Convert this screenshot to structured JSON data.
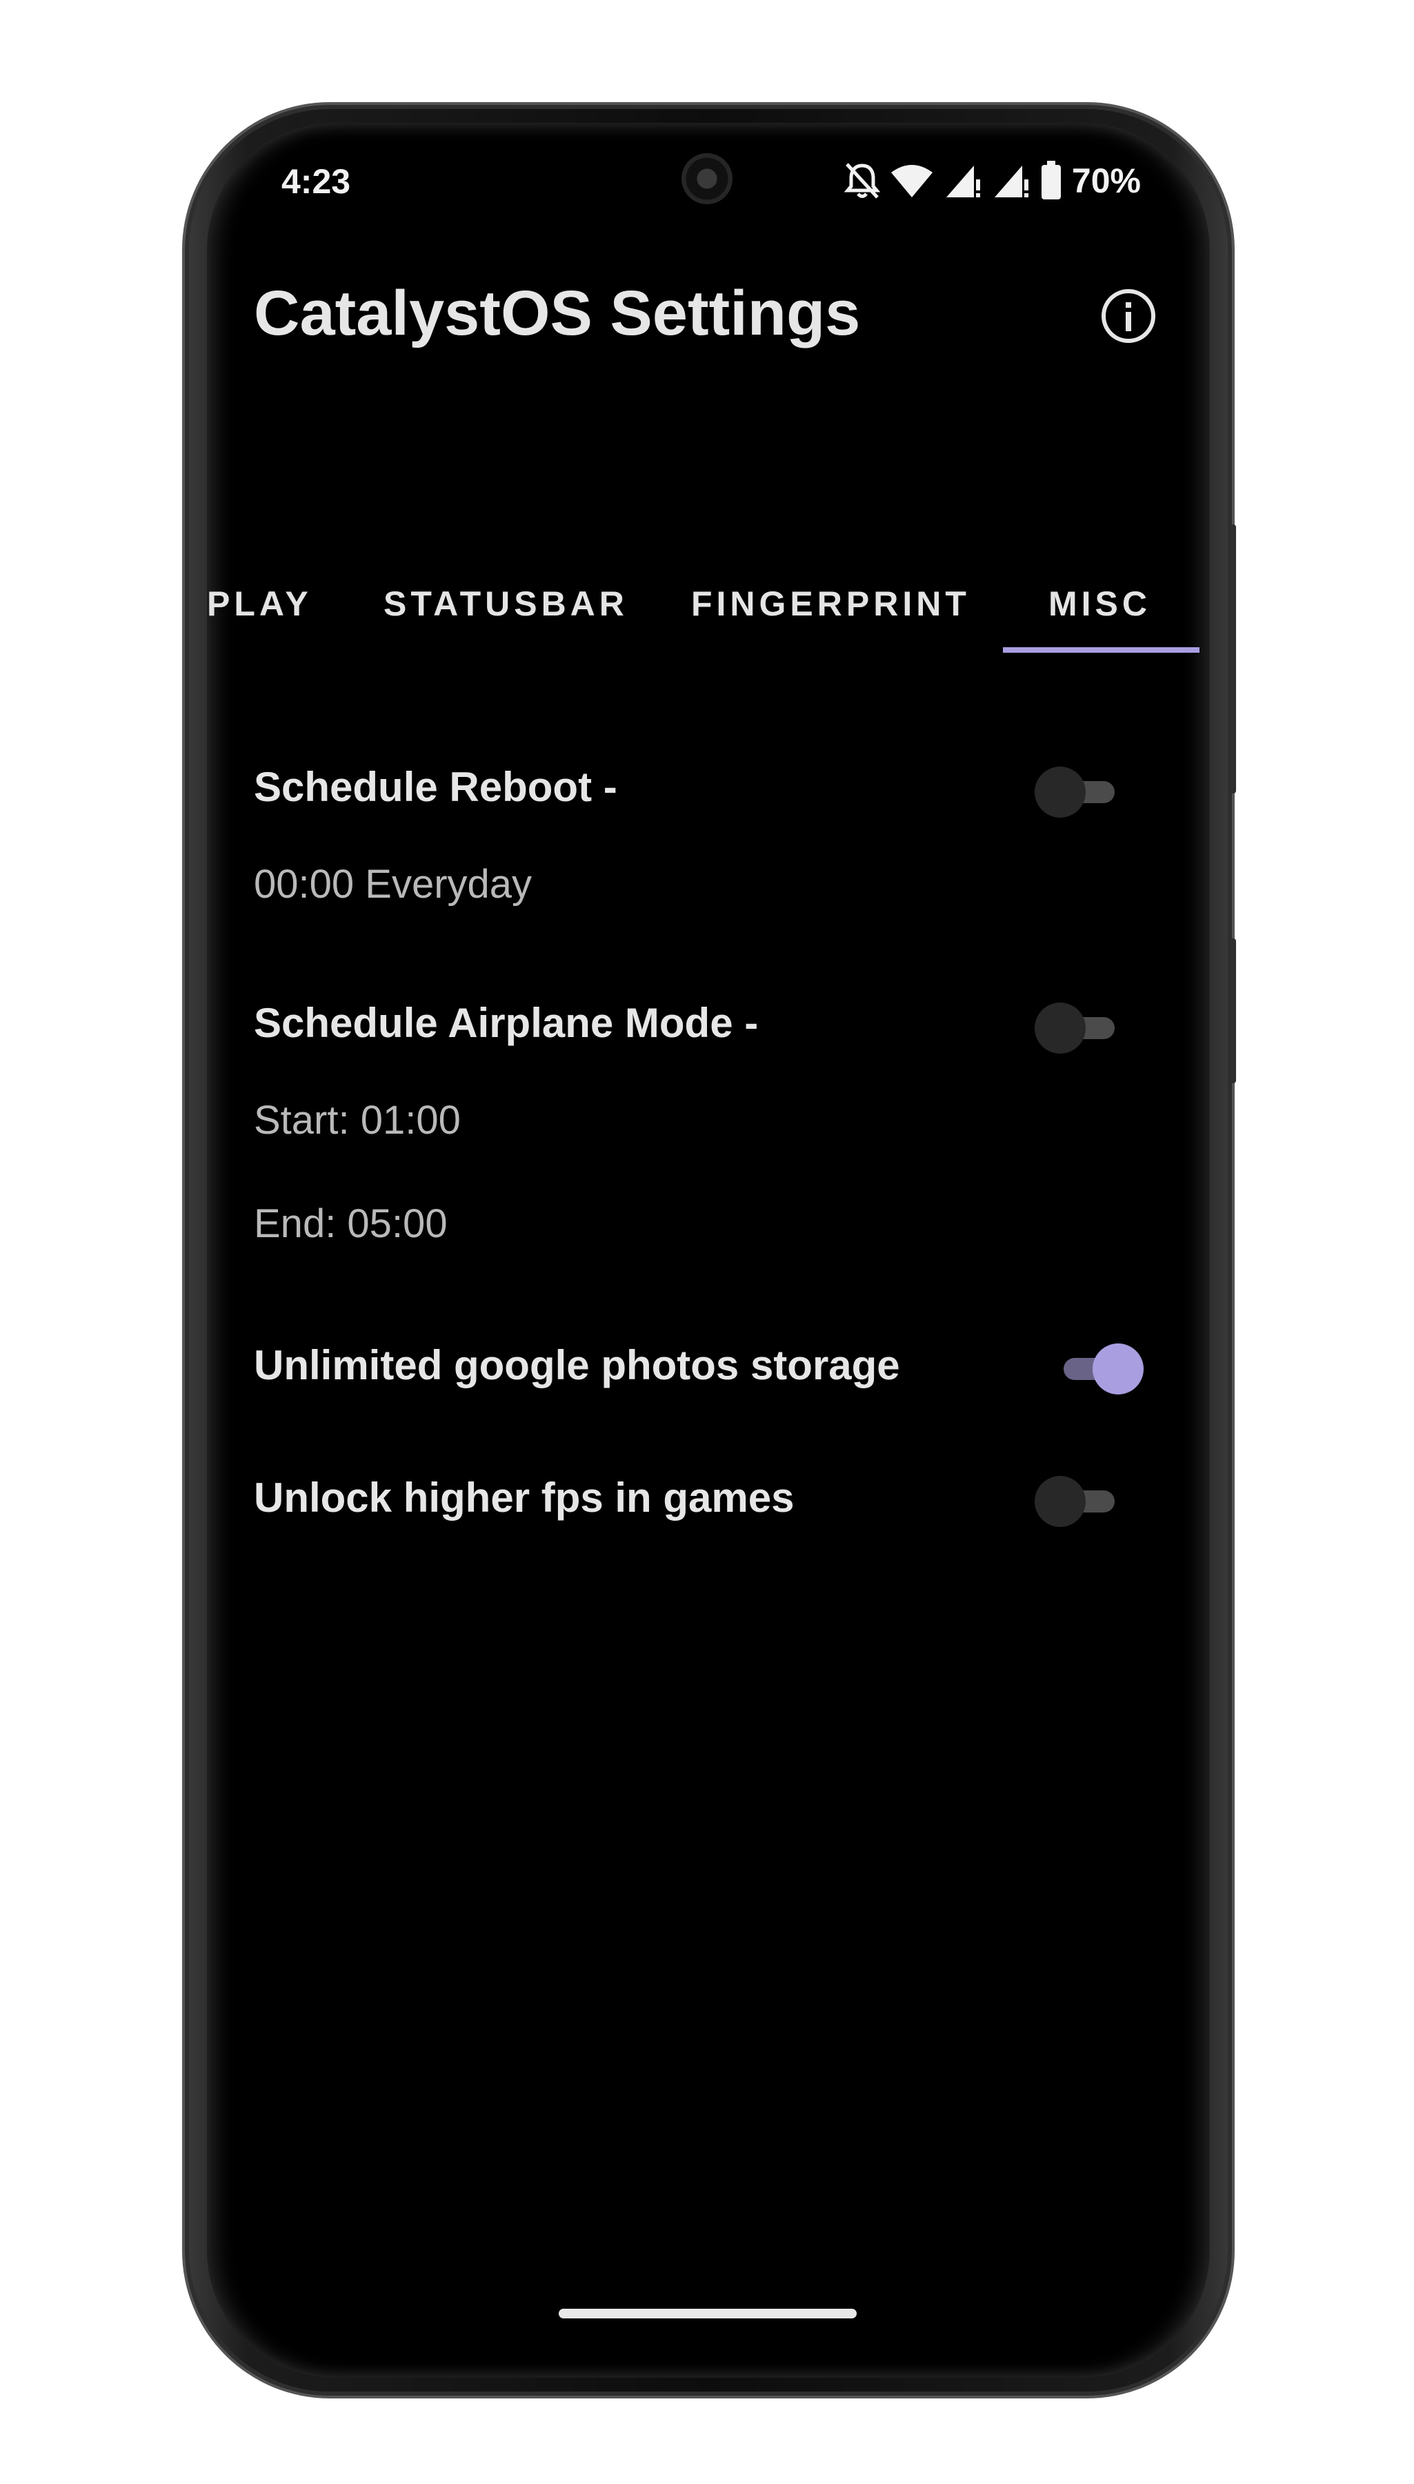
{
  "status_bar": {
    "time": "4:23",
    "battery": "70%",
    "icons": [
      "bell-off-icon",
      "wifi-icon",
      "signal-icon",
      "signal-icon",
      "battery-icon"
    ]
  },
  "header": {
    "title": "CatalystOS Settings",
    "info_icon": "info-icon"
  },
  "tabs": [
    {
      "label": "PLAY"
    },
    {
      "label": "STATUSBAR"
    },
    {
      "label": "FINGERPRINT"
    },
    {
      "label": "MISC",
      "selected": true
    }
  ],
  "settings": {
    "schedule_reboot": {
      "title": "Schedule Reboot -",
      "detail": "00:00 Everyday",
      "enabled": false
    },
    "schedule_airplane": {
      "title": "Schedule Airplane Mode -",
      "start": "Start: 01:00",
      "end": "End: 05:00",
      "enabled": false
    },
    "unlimited_photos": {
      "title": "Unlimited google photos storage",
      "enabled": true
    },
    "higher_fps": {
      "title": "Unlock higher fps in games",
      "enabled": false
    }
  },
  "colors": {
    "accent": "#a99ee0",
    "background": "#000000",
    "text_primary": "#e6e6e6",
    "text_secondary": "#b9b9b9"
  }
}
